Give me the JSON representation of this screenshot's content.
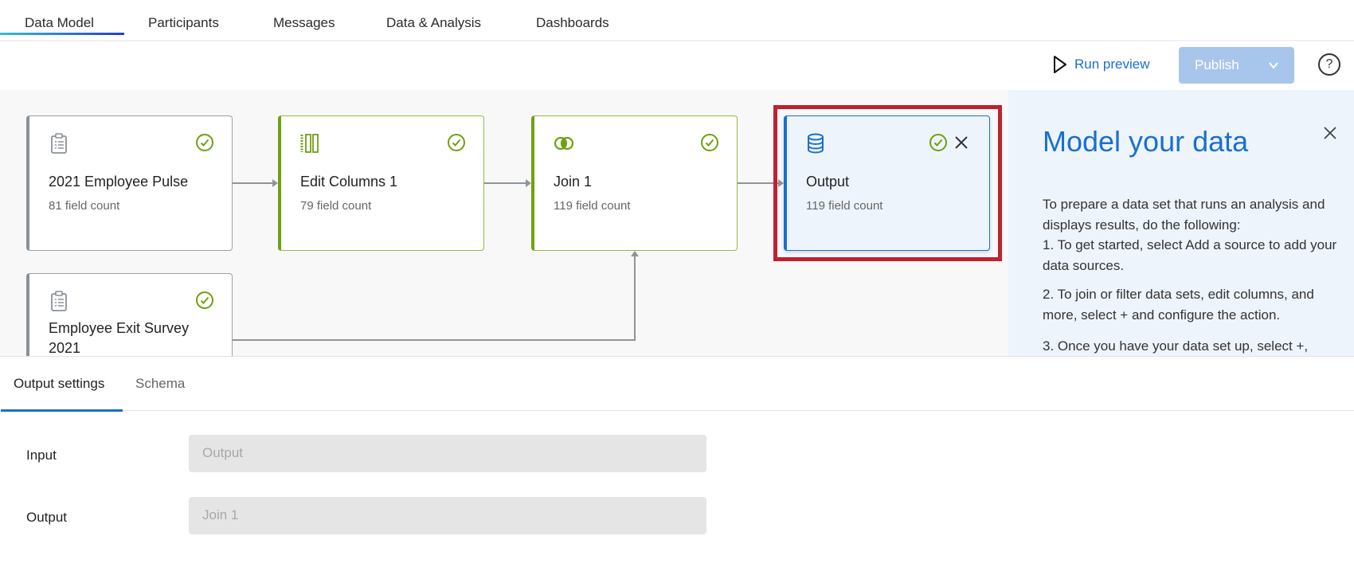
{
  "nav": {
    "tabs": [
      "Data Model",
      "Participants",
      "Messages",
      "Data & Analysis",
      "Dashboards"
    ],
    "active": "Data Model"
  },
  "toolbar": {
    "run_preview": "Run preview",
    "publish": "Publish",
    "help": "?"
  },
  "colors": {
    "accent": "#1a6fd0",
    "success": "#6fa012",
    "highlight": "#c0202f"
  },
  "nodes": [
    {
      "title": "2021 Employee Pulse",
      "count": "81 field count",
      "icon": "clipboard-icon"
    },
    {
      "title": "Edit Columns 1",
      "count": "79 field count",
      "icon": "columns-icon"
    },
    {
      "title": "Join 1",
      "count": "119 field count",
      "icon": "join-icon"
    },
    {
      "title": "Output",
      "count": "119 field count",
      "icon": "database-icon"
    },
    {
      "title": "Employee Exit Survey 2021",
      "icon": "clipboard-icon"
    }
  ],
  "panel": {
    "title": "Model your data",
    "intro": "To prepare a data set that runs an analysis and displays results, do the following:",
    "step1": "1. To get started, select Add a source to add your data sources.",
    "step2": "2. To join or filter data sets, edit columns, and more, select + and configure the action.",
    "step3": "3. Once you have your data set up, select +,"
  },
  "bottom": {
    "tabs": [
      "Output settings",
      "Schema"
    ],
    "input_label": "Input",
    "input_value": "Output",
    "output_label": "Output",
    "output_value": "Join 1"
  }
}
